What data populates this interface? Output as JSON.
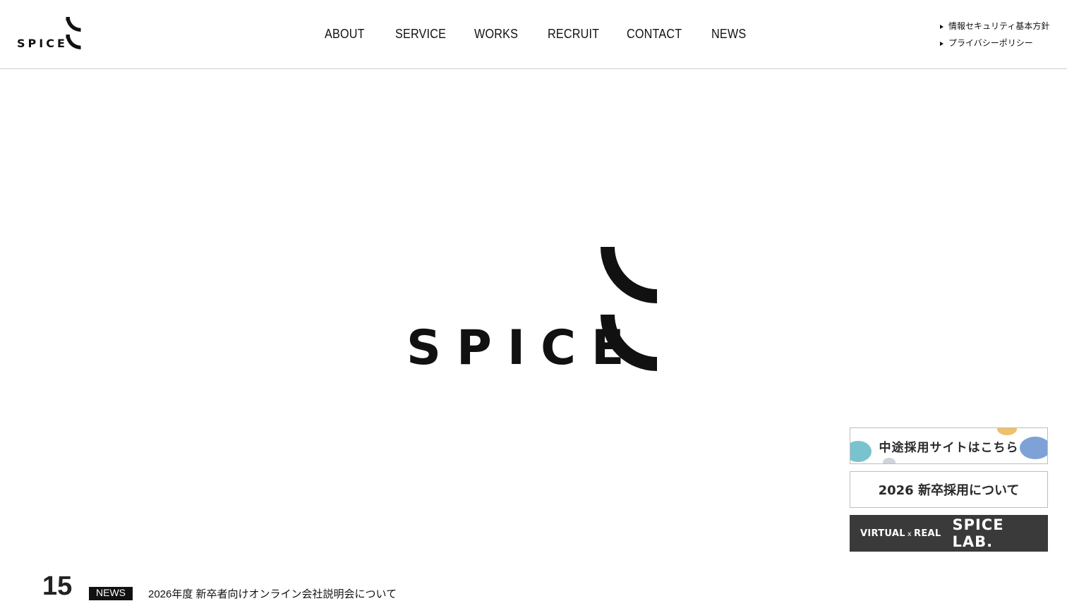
{
  "header": {
    "logo_text": "SPICE",
    "nav": [
      "ABOUT",
      "SERVICE",
      "WORKS",
      "RECRUIT",
      "CONTACT",
      "NEWS"
    ],
    "policy_links": [
      "情報セキュリティ基本方針",
      "プライバシーポリシー"
    ]
  },
  "hero": {
    "logo_text": "SPICE"
  },
  "banners": {
    "midcareer": "中途採用サイトはこちら",
    "newgrad": "2026 新卒採用について",
    "lab_prefix_a": "VIRTUAL",
    "lab_x": "x",
    "lab_prefix_b": "REAL",
    "lab_name": "SPICE LAB."
  },
  "news": {
    "day": "15",
    "tag": "NEWS",
    "title": "2026年度 新卒者向けオンライン会社説明会について"
  },
  "colors": {
    "text": "#111111",
    "banner_dark": "#3a3a3a",
    "divider": "#cfcfcf"
  }
}
